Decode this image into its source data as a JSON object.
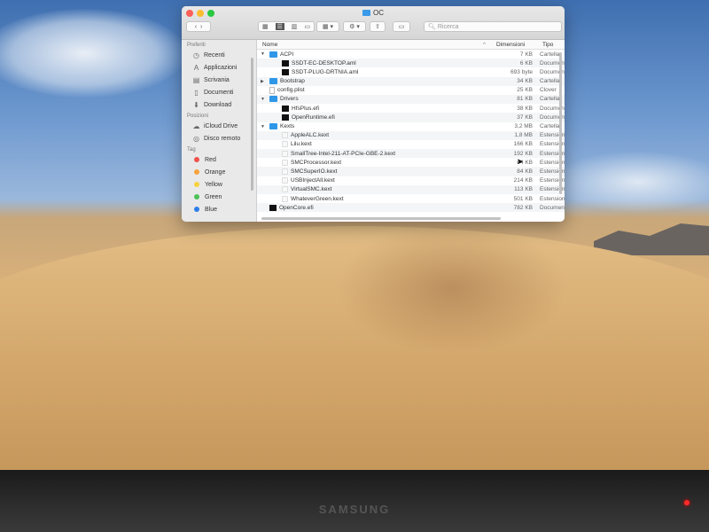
{
  "window": {
    "title": "OC",
    "search_placeholder": "Ricerca"
  },
  "sidebar": {
    "sections": [
      {
        "title": "Preferiti",
        "items": [
          {
            "label": "Recenti",
            "icon": "clock-icon"
          },
          {
            "label": "Applicazioni",
            "icon": "applications-icon"
          },
          {
            "label": "Scrivania",
            "icon": "desktop-icon"
          },
          {
            "label": "Documenti",
            "icon": "document-icon"
          },
          {
            "label": "Download",
            "icon": "download-icon"
          }
        ]
      },
      {
        "title": "Posizioni",
        "items": [
          {
            "label": "iCloud Drive",
            "icon": "cloud-icon"
          },
          {
            "label": "Disco remoto",
            "icon": "disc-icon"
          }
        ]
      },
      {
        "title": "Tag",
        "items": [
          {
            "label": "Red",
            "color": "#f0524c"
          },
          {
            "label": "Orange",
            "color": "#f5a33c"
          },
          {
            "label": "Yellow",
            "color": "#f6d33e"
          },
          {
            "label": "Green",
            "color": "#4cc256"
          },
          {
            "label": "Blue",
            "color": "#2f7ee8"
          }
        ]
      }
    ]
  },
  "columns": {
    "name": "Nome",
    "size": "Dimensioni",
    "type": "Tipo"
  },
  "rows": [
    {
      "name": "ACPI",
      "size": "7 KB",
      "type": "Cartella",
      "kind": "folder",
      "level": 0,
      "open": true
    },
    {
      "name": "SSDT-EC-DESKTOP.aml",
      "size": "6 KB",
      "type": "Documento",
      "kind": "file",
      "level": 1
    },
    {
      "name": "SSDT-PLUG-DRTNIA.aml",
      "size": "693 byte",
      "type": "Documento",
      "kind": "file",
      "level": 1
    },
    {
      "name": "Bootstrap",
      "size": "34 KB",
      "type": "Cartella",
      "kind": "folder",
      "level": 0,
      "open": false
    },
    {
      "name": "config.plist",
      "size": "25 KB",
      "type": "Clover",
      "kind": "plist",
      "level": 0
    },
    {
      "name": "Drivers",
      "size": "81 KB",
      "type": "Cartella",
      "kind": "folder",
      "level": 0,
      "open": true
    },
    {
      "name": "HfsPlus.efi",
      "size": "38 KB",
      "type": "Documento",
      "kind": "file",
      "level": 1
    },
    {
      "name": "OpenRuntime.efi",
      "size": "37 KB",
      "type": "Documento",
      "kind": "file",
      "level": 1
    },
    {
      "name": "Kexts",
      "size": "3,2 MB",
      "type": "Cartella",
      "kind": "folder",
      "level": 0,
      "open": true
    },
    {
      "name": "AppleALC.kext",
      "size": "1,8 MB",
      "type": "Estensione",
      "kind": "kext",
      "level": 1
    },
    {
      "name": "Lilu.kext",
      "size": "166 KB",
      "type": "Estensione",
      "kind": "kext",
      "level": 1
    },
    {
      "name": "SmallTree-Intel-211-AT-PCIe-GBE-2.kext",
      "size": "192 KB",
      "type": "Estensione",
      "kind": "kext",
      "level": 1
    },
    {
      "name": "SMCProcessor.kext",
      "size": "64 KB",
      "type": "Estensione",
      "kind": "kext",
      "level": 1
    },
    {
      "name": "SMCSuperIO.kext",
      "size": "84 KB",
      "type": "Estensione",
      "kind": "kext",
      "level": 1
    },
    {
      "name": "USBInjectAll.kext",
      "size": "214 KB",
      "type": "Estensione",
      "kind": "kext",
      "level": 1
    },
    {
      "name": "VirtualSMC.kext",
      "size": "113 KB",
      "type": "Estensione",
      "kind": "kext",
      "level": 1
    },
    {
      "name": "WhateverGreen.kext",
      "size": "501 KB",
      "type": "Estensione",
      "kind": "kext",
      "level": 1
    },
    {
      "name": "OpenCore.efi",
      "size": "782 KB",
      "type": "Documento",
      "kind": "file",
      "level": 0
    }
  ],
  "monitor": {
    "brand": "SAMSUNG"
  }
}
